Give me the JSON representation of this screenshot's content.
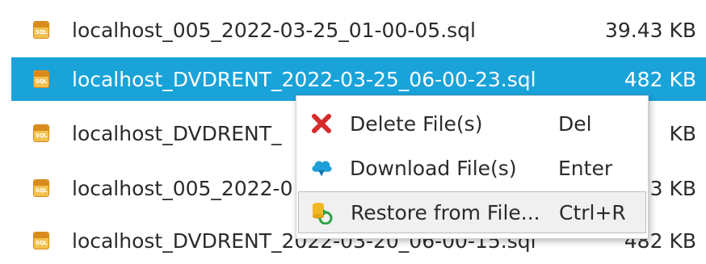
{
  "file_list": {
    "rows": [
      {
        "icon": "sql-file-icon",
        "icon_text": "SQL",
        "name": "localhost_005_2022-03-25_01-00-05.sql",
        "size": "39.43 KB",
        "selected": false
      },
      {
        "icon": "sql-file-icon",
        "icon_text": "SQL",
        "name": "localhost_DVDRENT_2022-03-25_06-00-23.sql",
        "size": "482 KB",
        "selected": true
      },
      {
        "icon": "sql-file-icon",
        "icon_text": "SQL",
        "name": "localhost_DVDRENT_",
        "size": "KB",
        "selected": false
      },
      {
        "icon": "sql-file-icon",
        "icon_text": "SQL",
        "name": "localhost_005_2022-0",
        "size": "3 KB",
        "selected": false
      },
      {
        "icon": "sql-file-icon",
        "icon_text": "SQL",
        "name": "localhost_DVDRENT_2022-03-20_06-00-15.sql",
        "size": "482 KB",
        "selected": false
      }
    ]
  },
  "context_menu": {
    "items": [
      {
        "icon": "delete-x-icon",
        "label": "Delete File(s)",
        "shortcut": "Del"
      },
      {
        "icon": "cloud-download-icon",
        "label": "Download File(s)",
        "shortcut": "Enter"
      },
      {
        "icon": "database-restore-icon",
        "label": "Restore from File...",
        "shortcut": "Ctrl+R",
        "highlighted": true
      }
    ]
  },
  "colors": {
    "selection": "#1aa3d9",
    "delete_icon": "#d62b2b",
    "download_icon": "#1f9fd8",
    "restore_db": "#f2b824",
    "restore_arrow": "#2ea043"
  }
}
